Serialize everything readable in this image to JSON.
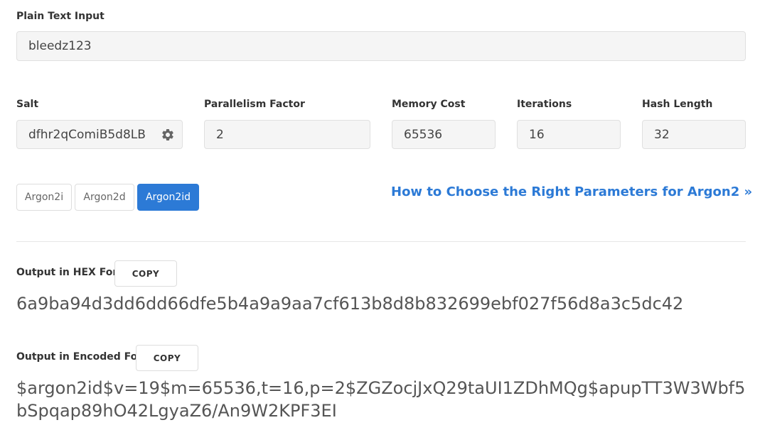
{
  "plain_text": {
    "label": "Plain Text Input",
    "value": "bleedz123"
  },
  "params": {
    "salt": {
      "label": "Salt",
      "value": "dfhr2qComiB5d8LB",
      "icon": "gear-icon"
    },
    "parallelism": {
      "label": "Parallelism Factor",
      "value": "2"
    },
    "memory": {
      "label": "Memory Cost",
      "value": "65536"
    },
    "iterations": {
      "label": "Iterations",
      "value": "16"
    },
    "hash_length": {
      "label": "Hash Length",
      "value": "32"
    }
  },
  "variants": {
    "items": [
      "Argon2i",
      "Argon2d",
      "Argon2id"
    ],
    "selected": "Argon2id",
    "active_color": "#2c7ad6"
  },
  "help_link": {
    "label": "How to Choose the Right Parameters for Argon2 »"
  },
  "output_hex": {
    "label": "Output in HEX Form",
    "copy_label": "COPY",
    "value": "6a9ba94d3dd6dd66dfe5b4a9a9aa7cf613b8d8b832699ebf027f56d8a3c5dc42"
  },
  "output_encoded": {
    "label": "Output in Encoded Form",
    "copy_label": "COPY",
    "value": "$argon2id$v=19$m=65536,t=16,p=2$ZGZocjJxQ29taUI1ZDhMQg$apupTT3W3Wbf5bSpqap89hO42LgyaZ6/An9W2KPF3EI"
  }
}
